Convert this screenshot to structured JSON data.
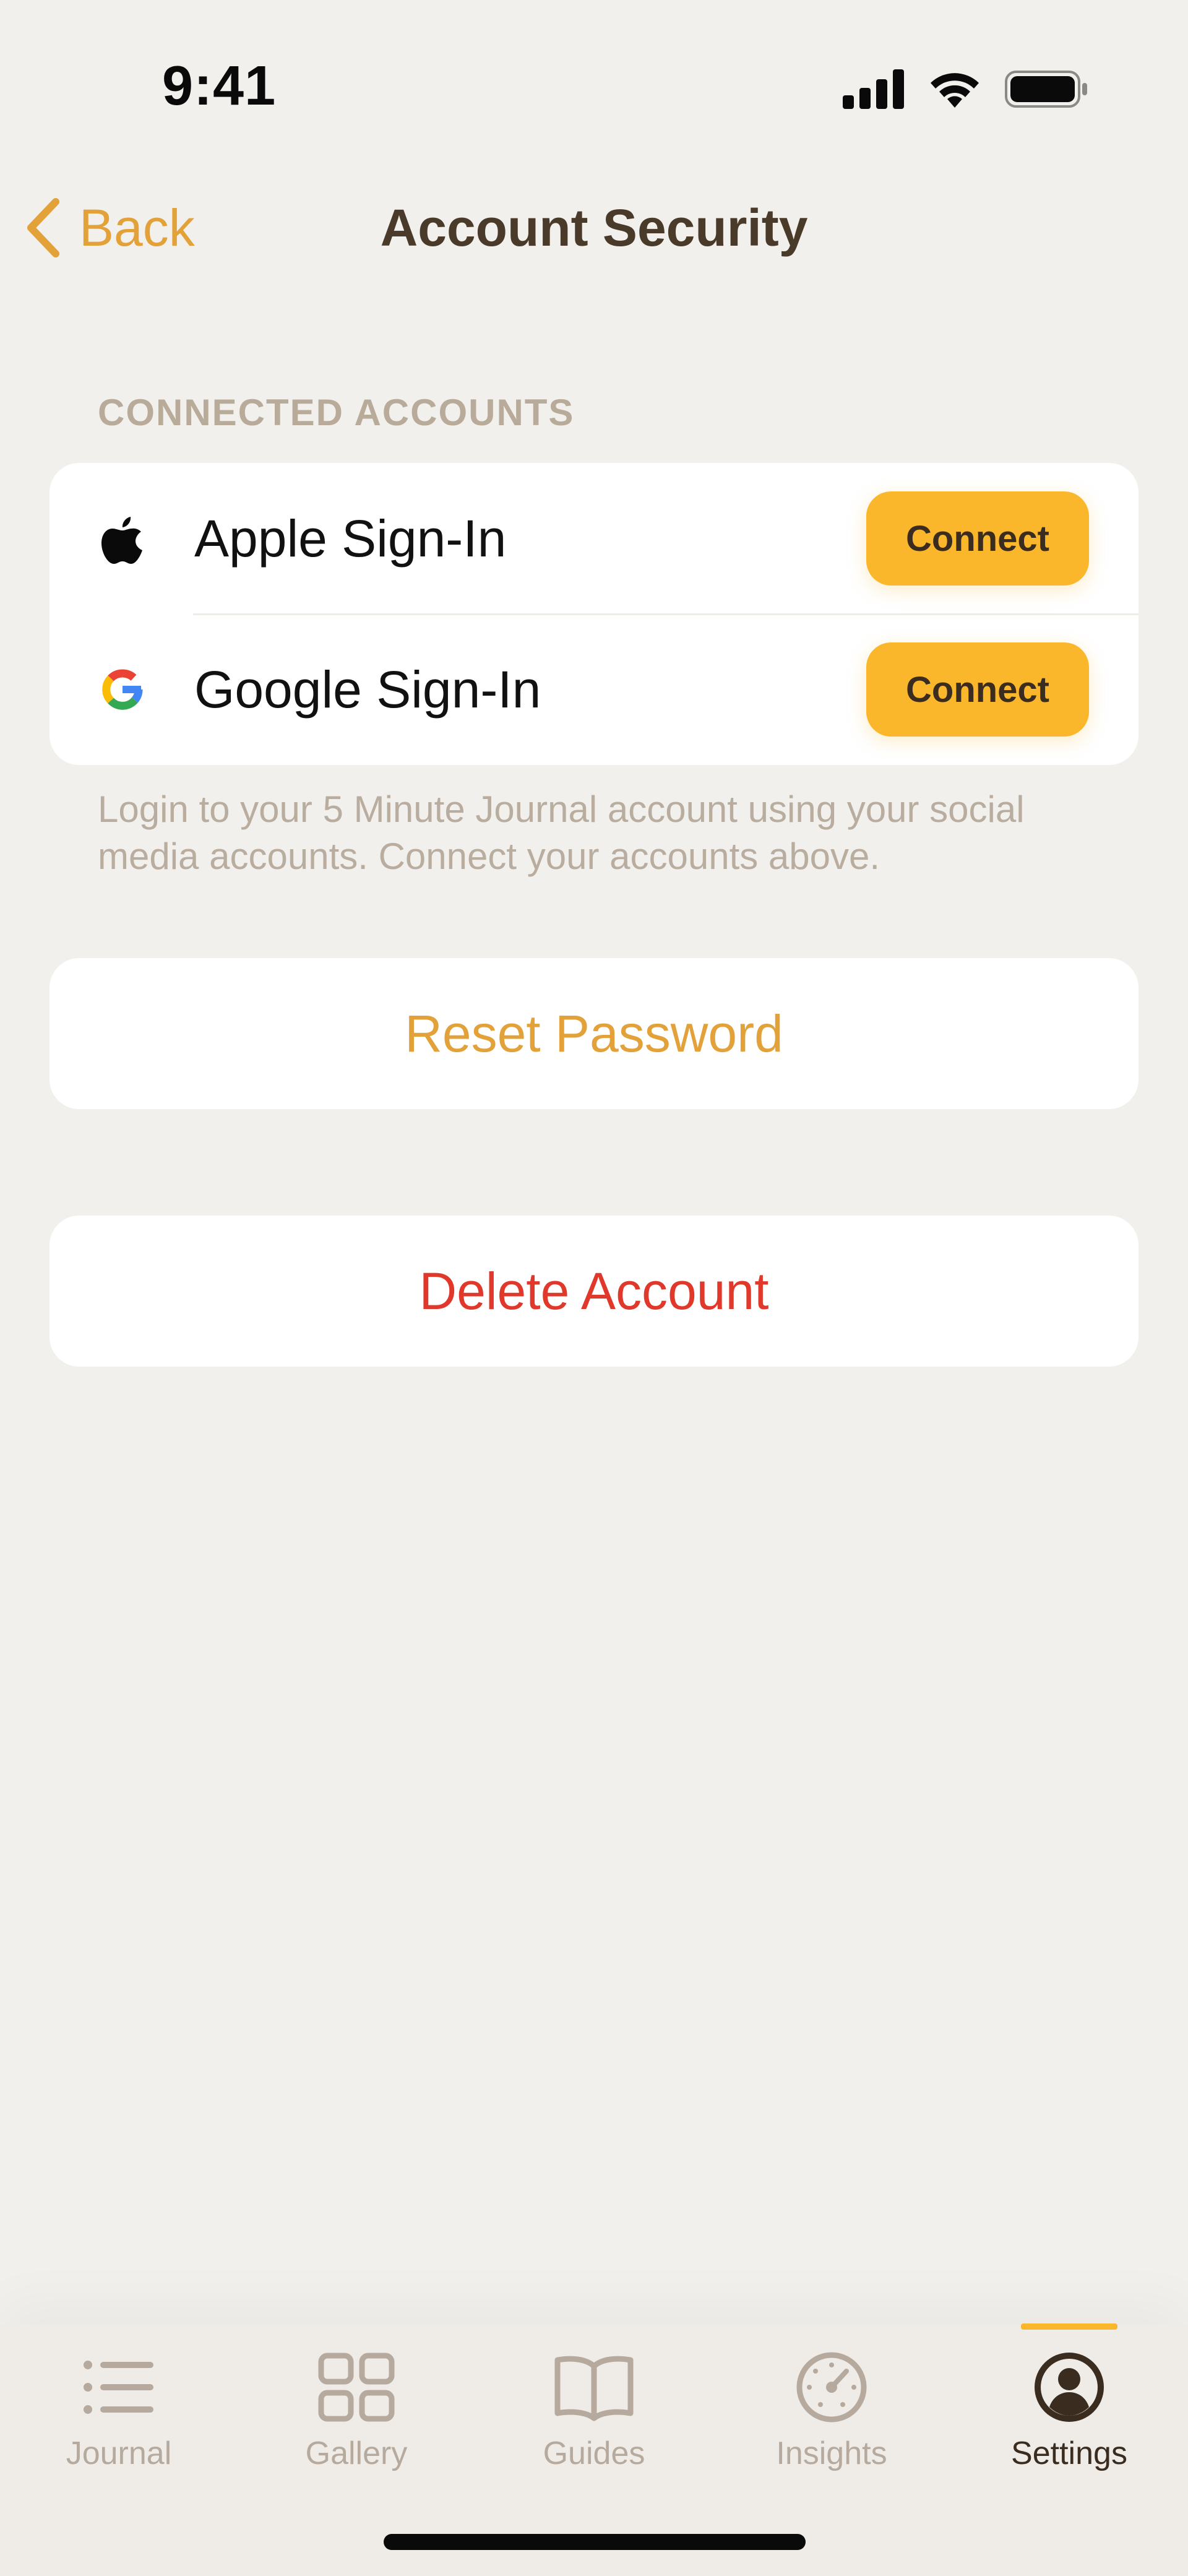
{
  "status_bar": {
    "time": "9:41"
  },
  "nav": {
    "back_label": "Back",
    "title": "Account Security"
  },
  "connected_accounts": {
    "header": "CONNECTED ACCOUNTS",
    "items": [
      {
        "label": "Apple Sign-In",
        "icon": "apple-icon",
        "button": "Connect"
      },
      {
        "label": "Google Sign-In",
        "icon": "google-icon",
        "button": "Connect"
      }
    ],
    "footnote": "Login to your 5 Minute Journal account using your social media accounts. Connect your accounts above."
  },
  "actions": {
    "reset_password": "Reset Password",
    "delete_account": "Delete Account"
  },
  "tabs": [
    {
      "label": "Journal",
      "icon": "list-icon",
      "active": false
    },
    {
      "label": "Gallery",
      "icon": "grid-icon",
      "active": false
    },
    {
      "label": "Guides",
      "icon": "book-icon",
      "active": false
    },
    {
      "label": "Insights",
      "icon": "gauge-icon",
      "active": false
    },
    {
      "label": "Settings",
      "icon": "person-circle-icon",
      "active": true
    }
  ],
  "colors": {
    "background": "#f2f0ec",
    "accent": "#e2a139",
    "button": "#fbb72c",
    "destructive": "#e0382a",
    "title": "#4a3a2a",
    "muted": "#b8ab9a"
  }
}
